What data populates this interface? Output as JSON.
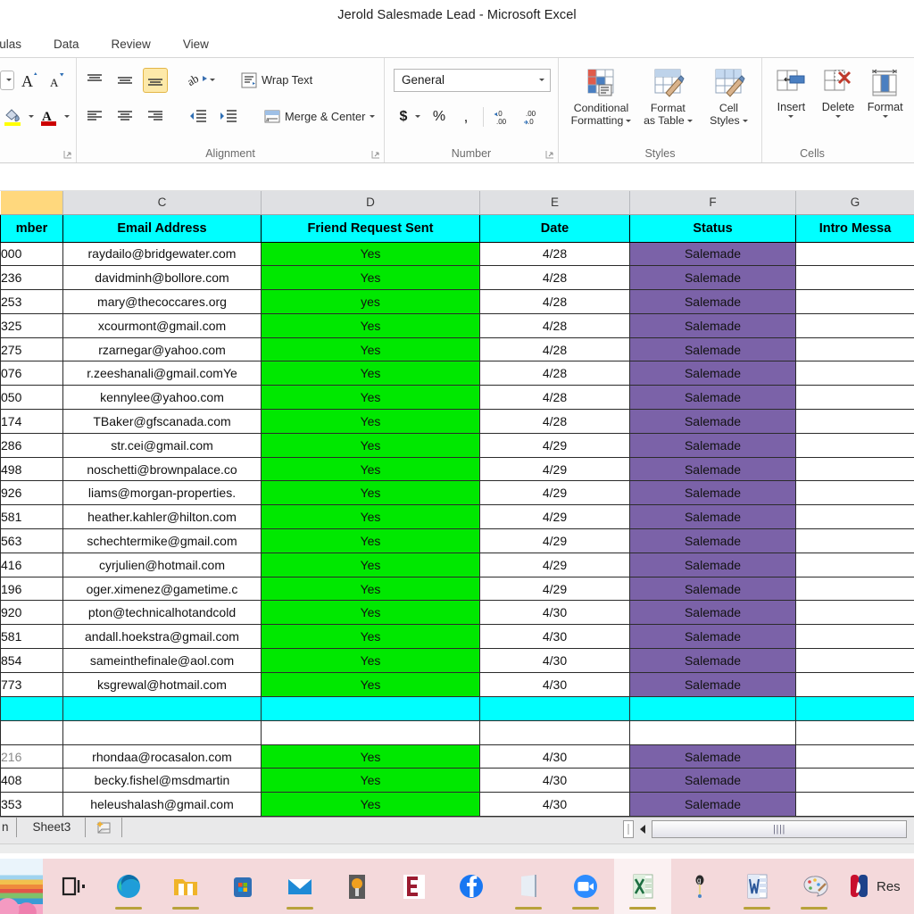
{
  "window": {
    "title": "Jerold Salesmade Lead  -  Microsoft Excel"
  },
  "ribbon": {
    "tabs": [
      "mulas",
      "Data",
      "Review",
      "View"
    ],
    "groups": [
      {
        "name": "Font",
        "label": ""
      },
      {
        "name": "Alignment",
        "label": "Alignment"
      },
      {
        "name": "Number",
        "label": "Number"
      },
      {
        "name": "Styles",
        "label": "Styles"
      },
      {
        "name": "Cells",
        "label": "Cells"
      }
    ],
    "alignment": {
      "wrap_text": "Wrap Text",
      "merge_center": "Merge & Center"
    },
    "number": {
      "format_value": "General",
      "currency": "$",
      "percent": "%",
      "comma": ","
    },
    "styles": {
      "conditional_formatting_l1": "Conditional",
      "conditional_formatting_l2": "Formatting",
      "format_as_table_l1": "Format",
      "format_as_table_l2": "as Table",
      "cell_styles_l1": "Cell",
      "cell_styles_l2": "Styles"
    },
    "cells": {
      "insert": "Insert",
      "delete": "Delete",
      "format": "Format"
    }
  },
  "sheet": {
    "column_letters": [
      "",
      "C",
      "D",
      "E",
      "F",
      "G"
    ],
    "headers": [
      "mber",
      "Email Address",
      "Friend Request Sent",
      "Date",
      "Status",
      "Intro Messa"
    ],
    "rows": [
      {
        "num": "000",
        "email": "raydailo@bridgewater.com",
        "sent": "Yes",
        "date": "4/28",
        "status": "Salemade",
        "intro": ""
      },
      {
        "num": "236",
        "email": "davidminh@bollore.com",
        "sent": "Yes",
        "date": "4/28",
        "status": "Salemade",
        "intro": ""
      },
      {
        "num": "253",
        "email": "mary@thecoccares.org",
        "sent": "yes",
        "date": "4/28",
        "status": "Salemade",
        "intro": ""
      },
      {
        "num": "325",
        "email": "xcourmont@gmail.com",
        "sent": "Yes",
        "date": "4/28",
        "status": "Salemade",
        "intro": ""
      },
      {
        "num": "275",
        "email": "rzarnegar@yahoo.com",
        "sent": "Yes",
        "date": "4/28",
        "status": "Salemade",
        "intro": ""
      },
      {
        "num": "076",
        "email": "r.zeeshanali@gmail.comYe",
        "sent": "Yes",
        "date": "4/28",
        "status": "Salemade",
        "intro": ""
      },
      {
        "num": "050",
        "email": "kennylee@yahoo.com",
        "sent": "Yes",
        "date": "4/28",
        "status": "Salemade",
        "intro": ""
      },
      {
        "num": "174",
        "email": "TBaker@gfscanada.com",
        "sent": "Yes",
        "date": "4/28",
        "status": "Salemade",
        "intro": ""
      },
      {
        "num": "286",
        "email": "str.cei@gmail.com",
        "sent": "Yes",
        "date": "4/29",
        "status": "Salemade",
        "intro": ""
      },
      {
        "num": "498",
        "email": "noschetti@brownpalace.co",
        "sent": "Yes",
        "date": "4/29",
        "status": "Salemade",
        "intro": ""
      },
      {
        "num": "926",
        "email": "liams@morgan-properties.",
        "sent": "Yes",
        "date": "4/29",
        "status": "Salemade",
        "intro": ""
      },
      {
        "num": "581",
        "email": "heather.kahler@hilton.com",
        "sent": "Yes",
        "date": "4/29",
        "status": "Salemade",
        "intro": ""
      },
      {
        "num": "563",
        "email": "schechtermike@gmail.com",
        "sent": "Yes",
        "date": "4/29",
        "status": "Salemade",
        "intro": ""
      },
      {
        "num": "416",
        "email": "cyrjulien@hotmail.com",
        "sent": "Yes",
        "date": "4/29",
        "status": "Salemade",
        "intro": ""
      },
      {
        "num": "196",
        "email": "oger.ximenez@gametime.c",
        "sent": "Yes",
        "date": "4/29",
        "status": "Salemade",
        "intro": ""
      },
      {
        "num": "920",
        "email": "pton@technicalhotandcold",
        "sent": "Yes",
        "date": "4/30",
        "status": "Salemade",
        "intro": ""
      },
      {
        "num": "581",
        "email": "andall.hoekstra@gmail.com",
        "sent": "Yes",
        "date": "4/30",
        "status": "Salemade",
        "intro": ""
      },
      {
        "num": "854",
        "email": "sameinthefinale@aol.com",
        "sent": "Yes",
        "date": "4/30",
        "status": "Salemade",
        "intro": ""
      },
      {
        "num": "773",
        "email": "ksgrewal@hotmail.com",
        "sent": "Yes",
        "date": "4/30",
        "status": "Salemade",
        "intro": ""
      }
    ],
    "rows_after_break": [
      {
        "num": "216",
        "email": "rhondaa@rocasalon.com",
        "sent": "Yes",
        "date": "4/30",
        "status": "Salemade",
        "intro": "",
        "faded": true
      },
      {
        "num": "408",
        "email": "becky.fishel@msdmartin",
        "sent": "Yes",
        "date": "4/30",
        "status": "Salemade",
        "intro": ""
      },
      {
        "num": "353",
        "email": "heleushalash@gmail.com",
        "sent": "Yes",
        "date": "4/30",
        "status": "Salemade",
        "intro": ""
      }
    ]
  },
  "sheetbar": {
    "tab_cut": "n",
    "tab_sheet3": "Sheet3",
    "scroll_grip": "||||"
  },
  "taskbar": {
    "items": [
      {
        "name": "task-view",
        "label": ""
      },
      {
        "name": "edge",
        "label": ""
      },
      {
        "name": "file-explorer",
        "label": ""
      },
      {
        "name": "microsoft-store",
        "label": ""
      },
      {
        "name": "mail",
        "label": ""
      },
      {
        "name": "media-player",
        "label": ""
      },
      {
        "name": "clippers-app",
        "label": ""
      },
      {
        "name": "facebook",
        "label": ""
      },
      {
        "name": "onenote",
        "label": ""
      },
      {
        "name": "zoom",
        "label": ""
      },
      {
        "name": "excel",
        "label": ""
      },
      {
        "name": "grammarly",
        "label": ""
      },
      {
        "name": "word",
        "label": ""
      },
      {
        "name": "paint",
        "label": ""
      }
    ],
    "nba_label": "Res"
  }
}
